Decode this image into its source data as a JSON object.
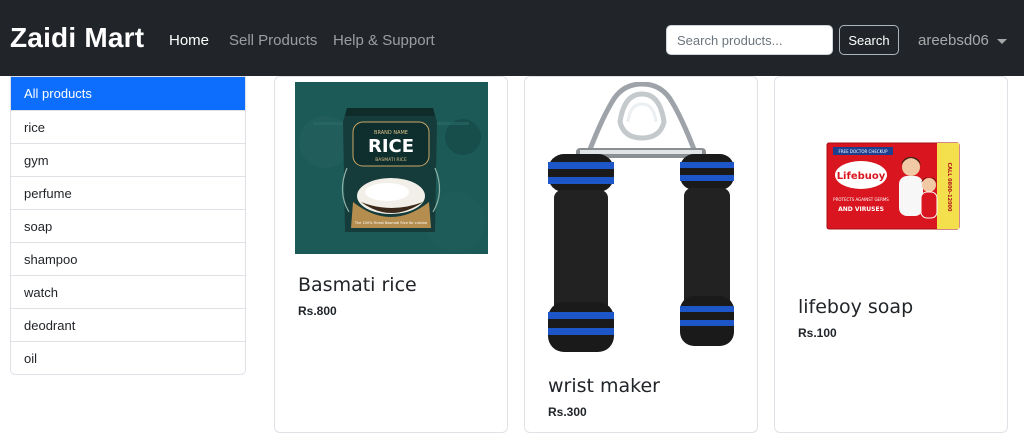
{
  "navbar": {
    "brand": "Zaidi Mart",
    "links": [
      {
        "label": "Home",
        "active": true
      },
      {
        "label": "Sell Products",
        "active": false
      },
      {
        "label": "Help & Support",
        "active": false
      }
    ],
    "search": {
      "placeholder": "Search products...",
      "value": "",
      "button_label": "Search"
    },
    "user": {
      "name": "areebsd06",
      "icon": "chevron-down-icon"
    }
  },
  "sidebar": {
    "items": [
      {
        "label": "All products",
        "active": true
      },
      {
        "label": "rice"
      },
      {
        "label": "gym"
      },
      {
        "label": "perfume"
      },
      {
        "label": "soap"
      },
      {
        "label": "shampoo"
      },
      {
        "label": "watch"
      },
      {
        "label": "deodrant"
      },
      {
        "label": "oil"
      }
    ]
  },
  "products": [
    {
      "title": "Basmati rice",
      "price": "Rs.800",
      "image_icon": "rice-package-image",
      "image_text": {
        "brand": "BRAND NAME",
        "name": "RICE",
        "sub": "BASMATI RICE",
        "foot": "The 100% Finest Basmati Rice for cuisine"
      }
    },
    {
      "title": "wrist maker",
      "price": "Rs.300",
      "image_icon": "hand-gripper-image"
    },
    {
      "title": "lifeboy soap",
      "price": "Rs.100",
      "image_icon": "soap-box-image",
      "image_text": {
        "badge": "FREE DOCTOR CHECKUP",
        "logo": "Lifebuoy",
        "line1": "PROTECTS AGAINST GERMS",
        "line2": "AND VIRUSES",
        "side": "CALL 0800-12000"
      }
    }
  ],
  "colors": {
    "navbar": "#212529",
    "accent": "#0d6efd",
    "rice_bg": "#1c5a58",
    "gripper_foam": "#1a1a1a",
    "gripper_blue": "#1d56c9",
    "soap_red": "#d9161f"
  }
}
